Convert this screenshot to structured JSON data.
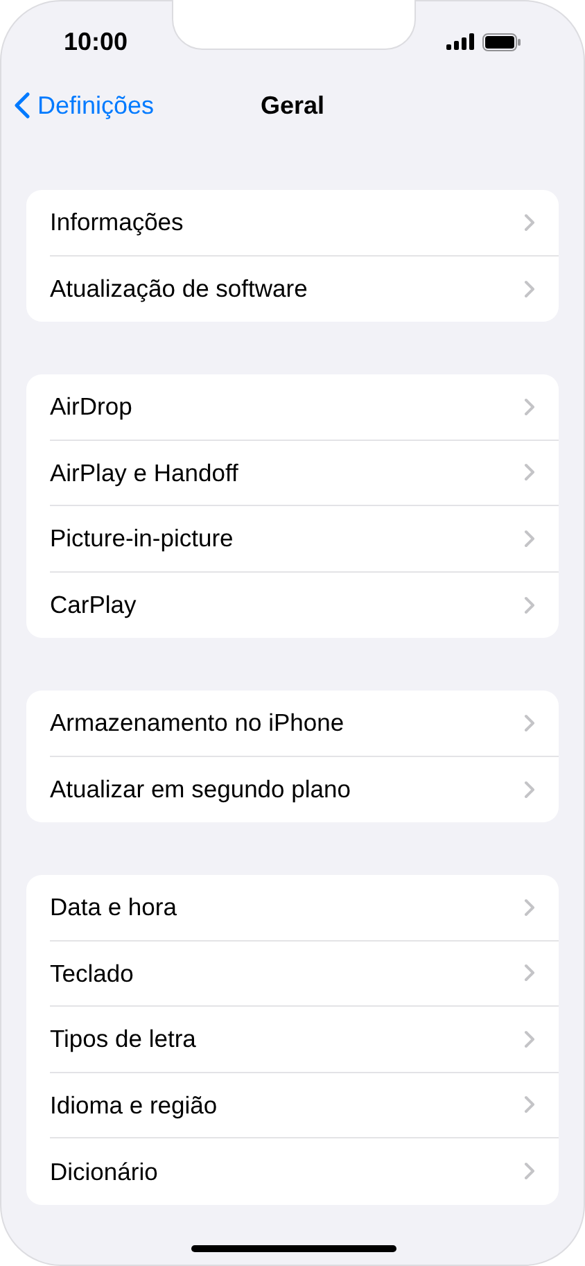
{
  "status_bar": {
    "time": "10:00"
  },
  "nav": {
    "back_label": "Definições",
    "title": "Geral"
  },
  "groups": [
    {
      "items": [
        {
          "label": "Informações"
        },
        {
          "label": "Atualização de software"
        }
      ]
    },
    {
      "items": [
        {
          "label": "AirDrop"
        },
        {
          "label": "AirPlay e Handoff"
        },
        {
          "label": "Picture-in-picture"
        },
        {
          "label": "CarPlay"
        }
      ]
    },
    {
      "items": [
        {
          "label": "Armazenamento no iPhone"
        },
        {
          "label": "Atualizar em segundo plano"
        }
      ]
    },
    {
      "items": [
        {
          "label": "Data e hora"
        },
        {
          "label": "Teclado"
        },
        {
          "label": "Tipos de letra"
        },
        {
          "label": "Idioma e região"
        },
        {
          "label": "Dicionário"
        }
      ]
    }
  ]
}
